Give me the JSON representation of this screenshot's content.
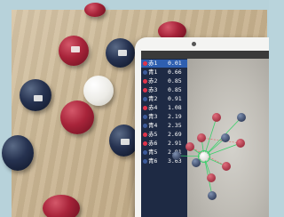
{
  "scene": {
    "description_tags": [
      "boccia-balls",
      "tablet-app"
    ]
  },
  "tablet": {
    "measurements": [
      {
        "team": "red",
        "label": "赤1",
        "value": "0.01"
      },
      {
        "team": "blue",
        "label": "青1",
        "value": "0.66"
      },
      {
        "team": "red",
        "label": "赤2",
        "value": "0.85"
      },
      {
        "team": "red",
        "label": "赤3",
        "value": "0.85"
      },
      {
        "team": "blue",
        "label": "青2",
        "value": "0.91"
      },
      {
        "team": "red",
        "label": "赤4",
        "value": "1.08"
      },
      {
        "team": "blue",
        "label": "青3",
        "value": "2.19"
      },
      {
        "team": "blue",
        "label": "青4",
        "value": "2.35"
      },
      {
        "team": "red",
        "label": "赤5",
        "value": "2.69"
      },
      {
        "team": "red",
        "label": "赤6",
        "value": "2.91"
      },
      {
        "team": "blue",
        "label": "青5",
        "value": "2.91"
      },
      {
        "team": "blue",
        "label": "青6",
        "value": "3.63"
      }
    ]
  },
  "colors": {
    "red": "#e0334a",
    "blue": "#3c5a9a",
    "selected": "#2e5fb0",
    "line": "#3ad06b"
  }
}
